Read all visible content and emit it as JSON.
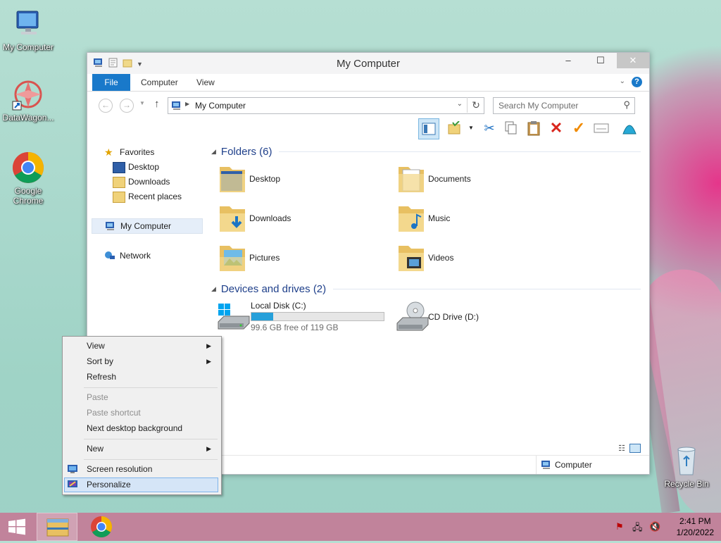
{
  "desktop": {
    "icons": [
      {
        "label": "My Computer"
      },
      {
        "label": "DataWagon..."
      },
      {
        "label": "Google Chrome"
      },
      {
        "label": "Recycle Bin"
      }
    ]
  },
  "window": {
    "title": "My Computer",
    "controls": {
      "minimize": "–",
      "maximize": "☐",
      "close": "✕"
    },
    "ribbon_tabs": [
      "File",
      "Computer",
      "View"
    ],
    "address": "My Computer",
    "search_placeholder": "Search My Computer",
    "nav": {
      "favorites": "Favorites",
      "desktop": "Desktop",
      "downloads": "Downloads",
      "recent": "Recent places",
      "computer": "My Computer",
      "network": "Network"
    },
    "folders_header": "Folders (6)",
    "folders": [
      {
        "name": "Desktop"
      },
      {
        "name": "Documents"
      },
      {
        "name": "Downloads"
      },
      {
        "name": "Music"
      },
      {
        "name": "Pictures"
      },
      {
        "name": "Videos"
      }
    ],
    "drives_header": "Devices and drives (2)",
    "drives": [
      {
        "name": "Local Disk (C:)",
        "free_text": "99.6 GB free of 119 GB",
        "used_fraction": 0.163
      },
      {
        "name": "CD Drive (D:)"
      }
    ],
    "status_location": "Computer"
  },
  "context_menu": {
    "items": [
      {
        "label": "View",
        "submenu": true
      },
      {
        "label": "Sort by",
        "submenu": true
      },
      {
        "label": "Refresh"
      },
      {
        "label": "Paste",
        "disabled": true
      },
      {
        "label": "Paste shortcut",
        "disabled": true
      },
      {
        "label": "Next desktop background"
      },
      {
        "label": "New",
        "submenu": true
      },
      {
        "label": "Screen resolution"
      },
      {
        "label": "Personalize",
        "highlighted": true
      }
    ]
  },
  "taskbar": {
    "time": "2:41 PM",
    "date": "1/20/2022"
  },
  "colors": {
    "accent": "#1979ca",
    "taskbar": "#c1839b",
    "drive_bar": "#26a0da"
  }
}
